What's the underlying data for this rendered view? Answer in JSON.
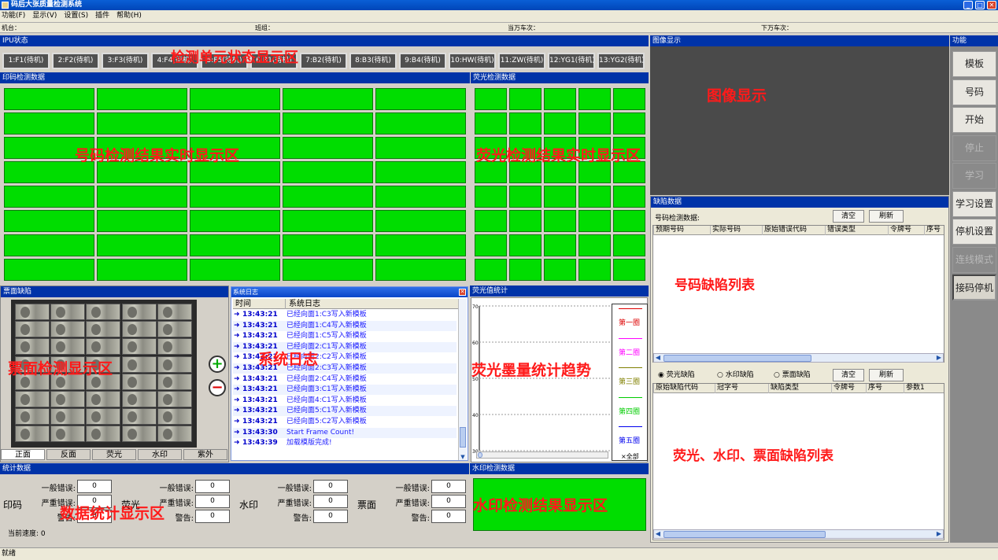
{
  "window": {
    "title": "码后大张质量检测系统",
    "minimize": "_",
    "maximize": "□",
    "close": "✕"
  },
  "menu": [
    "功能(F)",
    "显示(V)",
    "设置(S)",
    "插件",
    "帮助(H)"
  ],
  "info": {
    "machine": "机台：",
    "group": "班组：",
    "upper": "当万车次：",
    "lower": "下万车次："
  },
  "ipu": {
    "title": "IPU状态",
    "buttons": [
      "1:F1(待机)",
      "2:F2(待机)",
      "3:F3(待机)",
      "4:F4(待机)",
      "5:F5(待机)",
      "6:B1(待机)",
      "7:B2(待机)",
      "8:B3(待机)",
      "9:B4(待机)",
      "10:HW(待机)",
      "11:ZW(待机)",
      "12:YG1(待机)",
      "13:YG2(待机)"
    ],
    "annotation": "检测单元状态显示区"
  },
  "print": {
    "title": "印码检测数据",
    "annotation": "号码检测结果实时显示区"
  },
  "fluor": {
    "title": "荧光检测数据",
    "annotation": "荧光检测结果实时显示区"
  },
  "image": {
    "title": "图像显示",
    "annotation": "图像显示"
  },
  "functions": {
    "title": "功能",
    "buttons": [
      {
        "label": "模板",
        "enabled": true
      },
      {
        "label": "号码",
        "enabled": true
      },
      {
        "label": "开始",
        "enabled": true
      },
      {
        "label": "停止",
        "enabled": false
      },
      {
        "label": "学习",
        "enabled": false
      },
      {
        "label": "学习设置",
        "enabled": true
      },
      {
        "label": "停机设置",
        "enabled": true
      },
      {
        "label": "连线模式",
        "enabled": false
      },
      {
        "label": "接码停机",
        "enabled": true
      }
    ]
  },
  "defects": {
    "title": "缺陷数据",
    "number_label": "号码检测数据:",
    "clear": "清空",
    "refresh": "刷新",
    "number_columns": [
      "预期号码",
      "实际号码",
      "原始错误代码",
      "错误类型",
      "令牌号",
      "序号"
    ],
    "number_annotation": "号码缺陷列表",
    "radios": [
      "荧光缺陷",
      "水印缺陷",
      "票面缺陷"
    ],
    "selected_radio": "荧光缺陷",
    "lower_columns": [
      "原始缺陷代码",
      "冠字号",
      "缺陷类型",
      "令牌号",
      "序号",
      "参数1"
    ],
    "lower_annotation": "荧光、水印、票面缺陷列表"
  },
  "face": {
    "title": "票面缺陷",
    "annotation": "票面检测显示区",
    "tabs": [
      "正面",
      "反面",
      "荧光",
      "水印",
      "紫外"
    ],
    "zoom_in": "+",
    "zoom_out": "−"
  },
  "log": {
    "title": "系统日志",
    "col_time": "时间",
    "col_log": "系统日志",
    "annotation": "系统日志",
    "rows": [
      {
        "time": "13:43:21",
        "msg": "已经向面1:C3写入新模板"
      },
      {
        "time": "13:43:21",
        "msg": "已经向面1:C4写入新模板"
      },
      {
        "time": "13:43:21",
        "msg": "已经向面1:C5写入新模板"
      },
      {
        "time": "13:43:21",
        "msg": "已经向面2:C1写入新模板"
      },
      {
        "time": "13:43:21",
        "msg": "已经向面2:C2写入新模板"
      },
      {
        "time": "13:43:21",
        "msg": "已经向面2:C3写入新模板"
      },
      {
        "time": "13:43:21",
        "msg": "已经向面2:C4写入新模板"
      },
      {
        "time": "13:43:21",
        "msg": "已经向面3:C1写入新模板"
      },
      {
        "time": "13:43:21",
        "msg": "已经向面4:C1写入新模板"
      },
      {
        "time": "13:43:21",
        "msg": "已经向面5:C1写入新模板"
      },
      {
        "time": "13:43:21",
        "msg": "已经向面5:C2写入新模板"
      },
      {
        "time": "13:43:30",
        "msg": "Start Frame Count!"
      },
      {
        "time": "13:43:39",
        "msg": "加载模版完成!"
      }
    ]
  },
  "fstats": {
    "title": "荧光值统计",
    "annotation": "荧光墨量统计趋势",
    "legend": [
      "第一圈",
      "第二圈",
      "第三圈",
      "第四圈",
      "第五圈"
    ],
    "legend_colors": [
      "#dd0000",
      "#ff00ff",
      "#808000",
      "#00cc00",
      "#0000ee"
    ],
    "select_all": "×全部"
  },
  "chart_data": {
    "type": "line",
    "yticks": [
      "70",
      "60",
      "50",
      "40",
      "30"
    ],
    "ylim": [
      30,
      70
    ],
    "series": [
      {
        "name": "第一圈",
        "values": []
      },
      {
        "name": "第二圈",
        "values": []
      },
      {
        "name": "第三圈",
        "values": []
      },
      {
        "name": "第四圈",
        "values": []
      },
      {
        "name": "第五圈",
        "values": []
      }
    ]
  },
  "stats": {
    "title": "统计数据",
    "annotation": "数据统计显示区",
    "general": "一般错误:",
    "severe": "严重错误:",
    "warning": "警告:",
    "groups": [
      {
        "name": "印码",
        "values": [
          "0",
          "0",
          "0"
        ]
      },
      {
        "name": "荧光",
        "values": [
          "0",
          "0",
          "0"
        ]
      },
      {
        "name": "水印",
        "values": [
          "0",
          "0",
          "0"
        ]
      },
      {
        "name": "票面",
        "values": [
          "0",
          "0",
          "0"
        ]
      }
    ],
    "speed": "当前速度: 0"
  },
  "watermark": {
    "title": "水印检测数据",
    "annotation": "水印检测结果显示区"
  },
  "status_bar": "就绪"
}
